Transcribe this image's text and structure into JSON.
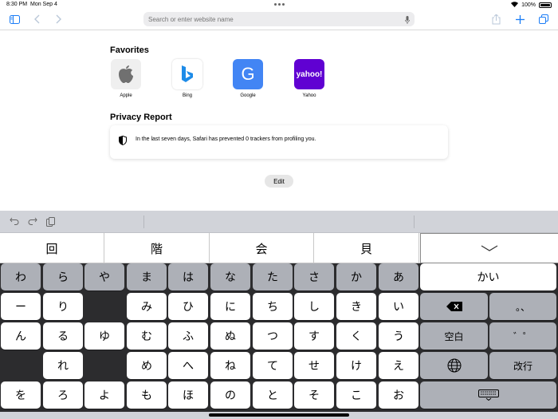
{
  "status": {
    "time": "8:30 PM",
    "date": "Mon Sep 4",
    "battery": "100%"
  },
  "toolbar": {
    "address_placeholder": "Search or enter website name",
    "icons": [
      "sidebar-icon",
      "back-icon",
      "forward-icon",
      "share-icon",
      "add-tab-icon",
      "tabs-icon",
      "microphone-icon"
    ]
  },
  "favorites": {
    "title": "Favorites",
    "items": [
      {
        "label": "Apple",
        "icon": "apple-logo-icon",
        "color": "#efefef"
      },
      {
        "label": "Bing",
        "icon": "bing-logo-icon",
        "color": "#ffffff"
      },
      {
        "label": "Google",
        "icon": "G",
        "color": "#4285f4"
      },
      {
        "label": "Yahoo",
        "icon": "yahoo!",
        "color": "#6001d2"
      }
    ]
  },
  "privacy": {
    "title": "Privacy Report",
    "message": "In the last seven days, Safari has prevented 0 trackers from profiling you."
  },
  "edit_label": "Edit",
  "keyboard": {
    "candidates": [
      "回",
      "階",
      "会",
      "貝"
    ],
    "rows": [
      [
        "わ",
        "ら",
        "や",
        "ま",
        "は",
        "な",
        "た",
        "さ",
        "か",
        "あ"
      ],
      [
        "ー",
        "り",
        "",
        "み",
        "ひ",
        "に",
        "ち",
        "し",
        "き",
        "い"
      ],
      [
        "ん",
        "る",
        "ゆ",
        "む",
        "ふ",
        "ぬ",
        "つ",
        "す",
        "く",
        "う"
      ],
      [
        "",
        "れ",
        "",
        "め",
        "へ",
        "ね",
        "て",
        "せ",
        "け",
        "え"
      ],
      [
        "を",
        "ろ",
        "よ",
        "も",
        "ほ",
        "の",
        "と",
        "そ",
        "こ",
        "お"
      ]
    ],
    "right_keys": {
      "composing": "かい",
      "punctuation": "。、",
      "space": "空白",
      "modifier": "゛゜",
      "return": "改行"
    },
    "colors": {
      "light_key": "#ffffff",
      "gray_key": "#adb0b7",
      "background": "#2c2c2e"
    }
  }
}
